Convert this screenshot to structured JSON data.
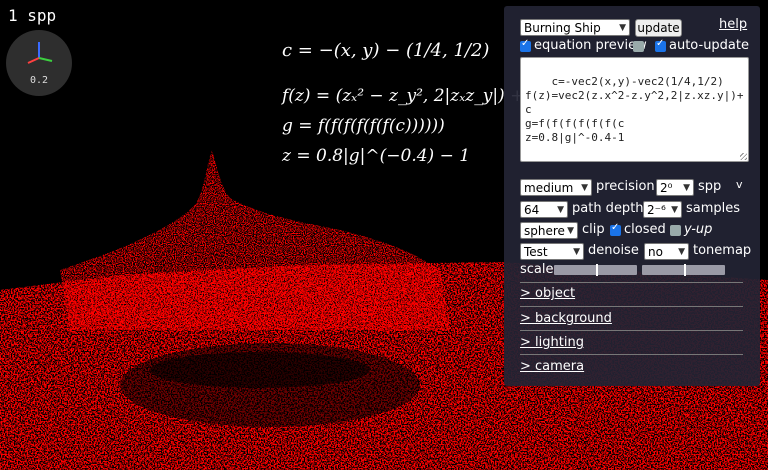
{
  "render": {
    "spp_text": "1 spp",
    "axis_scale": "0.2",
    "surface_color": "#ff0000",
    "background_color": "#000000"
  },
  "equations": {
    "c": "c = −(x, y) − (1/4, 1/2)",
    "f": "f(z) = (zₓ² − z_y², 2|zₓz_y|) + c",
    "g": "g = f(f(f(f(f(f(c))))))",
    "z": "z = 0.8|g|^(−0.4) − 1"
  },
  "panel": {
    "preset": "Burning Ship",
    "update_label": "update",
    "help_label": "help",
    "equation_preview_label": "equation preview",
    "equation_preview_checked": true,
    "extra_toggle_checked": false,
    "auto_update_label": "auto-update",
    "auto_update_checked": true,
    "equation_text": "c=-vec2(x,y)-vec2(1/4,1/2)\nf(z)=vec2(z.x^2-z.y^2,2|z.xz.y|)+c\ng=f(f(f(f(f(f(c\nz=0.8|g|^-0.4-1",
    "precision_value": "medium",
    "precision_label": "precision",
    "spp_value": "2⁰",
    "spp_label": "spp",
    "collapse_label": "v",
    "path_depth_value": "64",
    "path_depth_label": "path depth",
    "samples_value": "2⁻⁶",
    "samples_label": "samples",
    "clip_value": "sphere",
    "clip_label": "clip",
    "closed_label": "closed",
    "closed_checked": true,
    "y_up_label": "y-up",
    "y_up_checked": false,
    "denoise_value": "Test",
    "denoise_label": "denoise",
    "tonemap_value": "no",
    "tonemap_label": "tonemap",
    "scale_label": "scale",
    "scale_slider_1": 0.5,
    "scale_slider_2": 0.5,
    "sections": [
      "> object",
      "> background",
      "> lighting",
      "> camera"
    ]
  }
}
